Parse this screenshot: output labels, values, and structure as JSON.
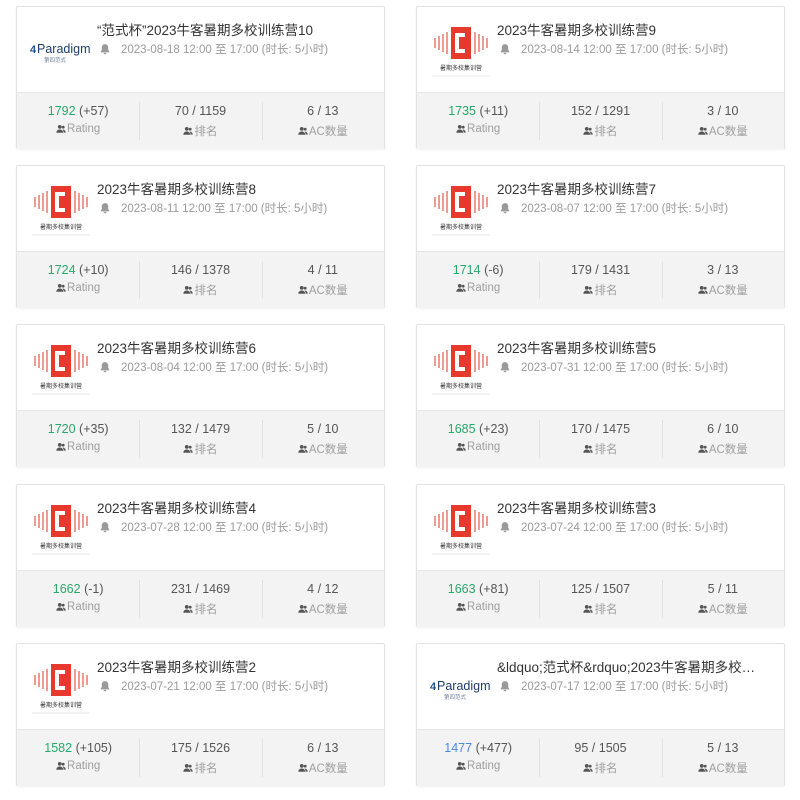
{
  "labels": {
    "rating": "Rating",
    "rank": "排名",
    "ac": "AC数量"
  },
  "logos": {
    "paradigm_text": "Paradigm",
    "paradigm_num": "4",
    "paradigm_sub": "第四范式",
    "school_sub": "暑期多校集训营"
  },
  "colors": {
    "rating_green": "#27a96b",
    "rating_blue": "#4a86e8",
    "logo_red": "#e8392d"
  },
  "cards": [
    {
      "title": "“范式杯”2023牛客暑期多校训练营10",
      "time": "2023-08-18 12:00 至 17:00   (时长:   5小时)",
      "logo": "paradigm",
      "rating": "1792",
      "delta": "(+57)",
      "rating_color": "green",
      "rank": "70 / 1159",
      "ac": "6 / 13"
    },
    {
      "title": "2023牛客暑期多校训练营9",
      "time": "2023-08-14 12:00 至 17:00   (时长:   5小时)",
      "logo": "school",
      "rating": "1735",
      "delta": "(+11)",
      "rating_color": "green",
      "rank": "152 / 1291",
      "ac": "3 / 10"
    },
    {
      "title": "2023牛客暑期多校训练营8",
      "time": "2023-08-11 12:00 至 17:00   (时长:   5小时)",
      "logo": "school",
      "rating": "1724",
      "delta": "(+10)",
      "rating_color": "green",
      "rank": "146 / 1378",
      "ac": "4 / 11"
    },
    {
      "title": "2023牛客暑期多校训练营7",
      "time": "2023-08-07 12:00 至 17:00   (时长:   5小时)",
      "logo": "school",
      "rating": "1714",
      "delta": "(-6)",
      "rating_color": "green",
      "rank": "179 / 1431",
      "ac": "3 / 13"
    },
    {
      "title": "2023牛客暑期多校训练营6",
      "time": "2023-08-04 12:00 至 17:00   (时长:   5小时)",
      "logo": "school",
      "rating": "1720",
      "delta": "(+35)",
      "rating_color": "green",
      "rank": "132 / 1479",
      "ac": "5 / 10"
    },
    {
      "title": "2023牛客暑期多校训练营5",
      "time": "2023-07-31 12:00 至 17:00   (时长:   5小时)",
      "logo": "school",
      "rating": "1685",
      "delta": "(+23)",
      "rating_color": "green",
      "rank": "170 / 1475",
      "ac": "6 / 10"
    },
    {
      "title": "2023牛客暑期多校训练营4",
      "time": "2023-07-28 12:00 至 17:00   (时长:   5小时)",
      "logo": "school",
      "rating": "1662",
      "delta": "(-1)",
      "rating_color": "green",
      "rank": "231 / 1469",
      "ac": "4 / 12"
    },
    {
      "title": "2023牛客暑期多校训练营3",
      "time": "2023-07-24 12:00 至 17:00   (时长:   5小时)",
      "logo": "school",
      "rating": "1663",
      "delta": "(+81)",
      "rating_color": "green",
      "rank": "125 / 1507",
      "ac": "5 / 11"
    },
    {
      "title": "2023牛客暑期多校训练营2",
      "time": "2023-07-21 12:00 至 17:00   (时长:   5小时)",
      "logo": "school",
      "rating": "1582",
      "delta": "(+105)",
      "rating_color": "green",
      "rank": "175 / 1526",
      "ac": "6 / 13"
    },
    {
      "title": "&ldquo;范式杯&rdquo;2023牛客暑期多校…",
      "time": "2023-07-17 12:00 至 17:00   (时长:   5小时)",
      "logo": "paradigm",
      "rating": "1477",
      "delta": "(+477)",
      "rating_color": "blue",
      "rank": "95 / 1505",
      "ac": "5 / 13"
    }
  ]
}
